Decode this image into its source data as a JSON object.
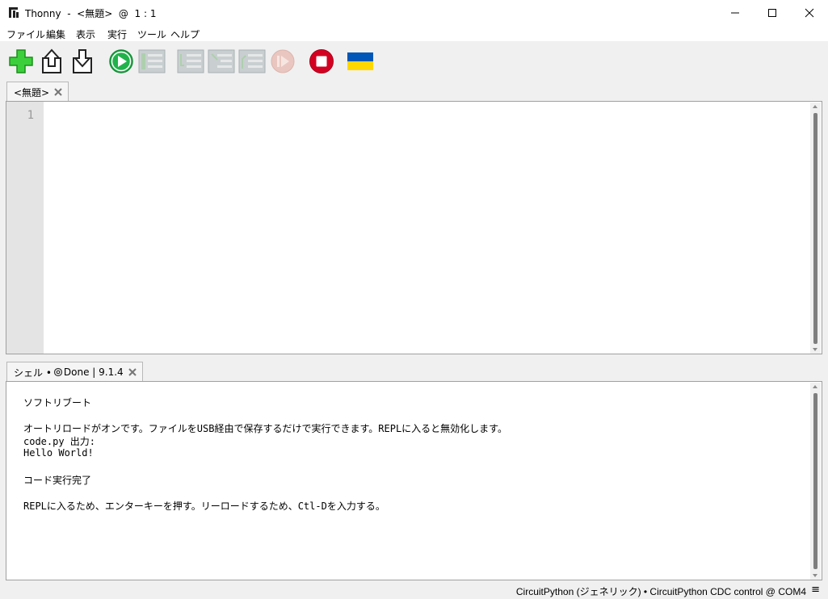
{
  "window": {
    "title": "Thonny  -  <無題>  @  1 : 1"
  },
  "menu": [
    "ファイル",
    "編集",
    "表示",
    "実行",
    "ツール",
    "ヘルプ"
  ],
  "toolbar": {
    "icons": [
      "new-file-icon",
      "open-file-icon",
      "save-file-icon",
      "run-icon",
      "debug-icon",
      "step-over-icon",
      "step-into-icon",
      "step-out-icon",
      "resume-icon",
      "stop-icon",
      "ukraine-flag-icon"
    ]
  },
  "editor": {
    "tab_label": "<無題>",
    "line_numbers": [
      "1"
    ]
  },
  "shell": {
    "tab_label": "シェル • ",
    "tab_status": "Done | 9.1.4",
    "lines": [
      "ソフトリブート",
      "",
      "オートリロードがオンです。ファイルをUSB経由で保存するだけで実行できます。REPLに入ると無効化します。",
      "code.py 出力:",
      "Hello World!",
      "",
      "コード実行完了",
      "",
      "REPLに入るため、エンターキーを押す。リーロードするため、Ctl-Dを入力する。"
    ]
  },
  "status": {
    "text": "CircuitPython (ジェネリック)  •  CircuitPython CDC control @ COM4",
    "menu_glyph": "≡"
  },
  "colors": {
    "run": "#22b24c",
    "stop": "#d40022",
    "flag_blue": "#0057b7",
    "flag_yellow": "#ffd700"
  }
}
